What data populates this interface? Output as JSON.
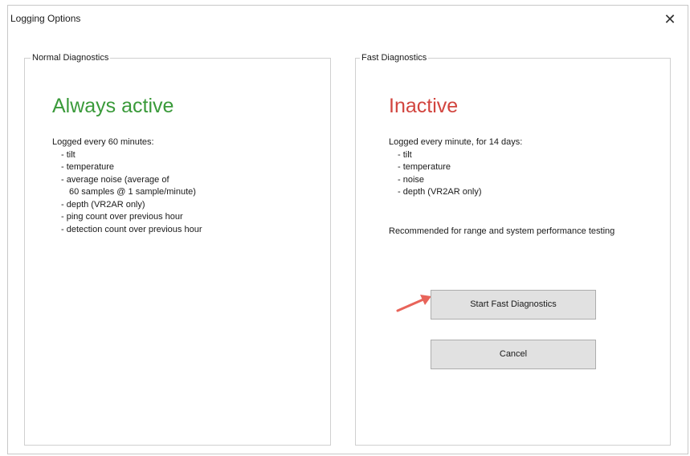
{
  "window": {
    "title": "Logging Options",
    "close_glyph": "✕"
  },
  "normal": {
    "legend": "Normal Diagnostics",
    "status": "Always active",
    "status_color": "#3a9a3a",
    "lines": [
      "Logged every 60 minutes:",
      "- tilt",
      "- temperature",
      "- average noise (average of",
      "60 samples @ 1 sample/minute)",
      "- depth (VR2AR only)",
      "- ping count over previous hour",
      "- detection count over previous hour"
    ]
  },
  "fast": {
    "legend": "Fast Diagnostics",
    "status": "Inactive",
    "status_color": "#d2453f",
    "lines": [
      "Logged every minute, for 14 days:",
      "- tilt",
      "- temperature",
      "- noise",
      "- depth (VR2AR only)"
    ],
    "recommendation": "Recommended for range and system performance testing",
    "start_button_label": "Start Fast Diagnostics",
    "cancel_button_label": "Cancel"
  },
  "annotation": {
    "arrow_icon": "red-arrow-icon",
    "arrow_color": "#e8645a"
  }
}
